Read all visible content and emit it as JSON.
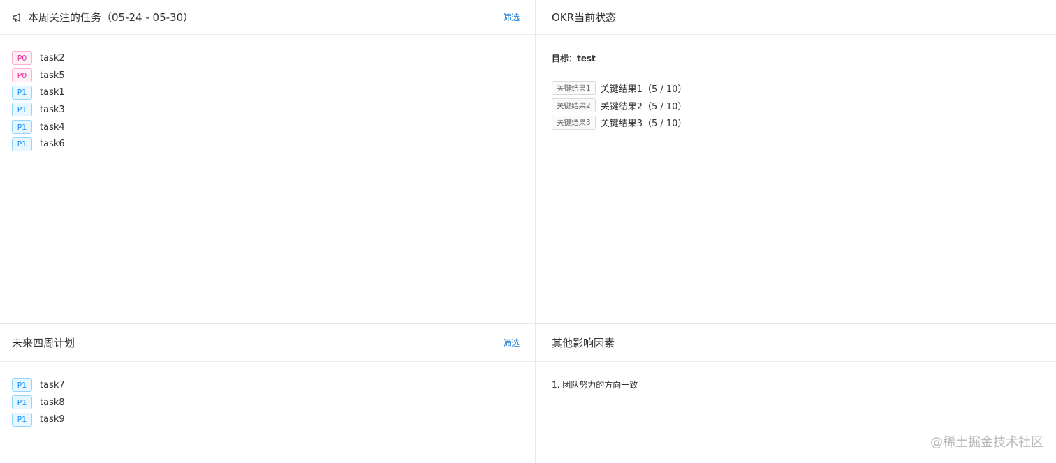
{
  "panels": {
    "weekly": {
      "title": "本周关注的任务（05-24 - 05-30）",
      "filter_label": "筛选",
      "tasks": [
        {
          "priority": "P0",
          "name": "task2"
        },
        {
          "priority": "P0",
          "name": "task5"
        },
        {
          "priority": "P1",
          "name": "task1"
        },
        {
          "priority": "P1",
          "name": "task3"
        },
        {
          "priority": "P1",
          "name": "task4"
        },
        {
          "priority": "P1",
          "name": "task6"
        }
      ]
    },
    "okr": {
      "title": "OKR当前状态",
      "goal": "目标：test",
      "key_results": [
        {
          "tag": "关键结果1",
          "text": "关键结果1（5 / 10）"
        },
        {
          "tag": "关键结果2",
          "text": "关键结果2（5 / 10）"
        },
        {
          "tag": "关键结果3",
          "text": "关键结果3（5 / 10）"
        }
      ]
    },
    "future": {
      "title": "未来四周计划",
      "filter_label": "筛选",
      "tasks": [
        {
          "priority": "P1",
          "name": "task7"
        },
        {
          "priority": "P1",
          "name": "task8"
        },
        {
          "priority": "P1",
          "name": "task9"
        }
      ]
    },
    "factors": {
      "title": "其他影响因素",
      "items": [
        "1. 团队努力的方向一致"
      ]
    }
  },
  "watermark": "@稀土掘金技术社区",
  "colors": {
    "accent": "#1e7fd6",
    "p0": "#eb2f96",
    "p1": "#1890ff"
  }
}
